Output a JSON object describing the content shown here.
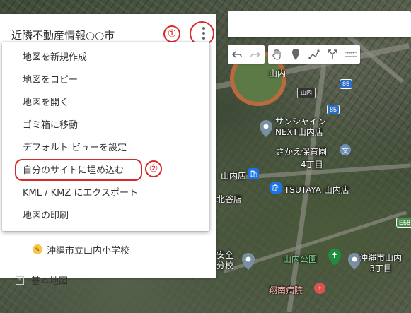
{
  "panel": {
    "title": "近隣不動産情報○○市",
    "school_label": "沖縄市立山内小学校",
    "basemap_label": "基本地図"
  },
  "menu": {
    "items": [
      "地図を新規作成",
      "地図をコピー",
      "地図を開く",
      "ゴミ箱に移動",
      "デフォルト ビューを設定",
      "自分のサイトに埋め込む",
      "KML / KMZ にエクスポート",
      "地図の印刷"
    ]
  },
  "annotations": {
    "badge_1": "①",
    "badge_2": "②"
  },
  "search": {
    "placeholder": ""
  },
  "toolbar": {
    "icons": [
      "undo-icon",
      "redo-icon",
      "hand-icon",
      "marker-icon",
      "line-icon",
      "directions-icon",
      "ruler-icon"
    ]
  },
  "map": {
    "labels": {
      "yamauchi": "山内",
      "yamauchi_sign": "山内",
      "sunshine": "サンシャイン\nNEXT山内店",
      "sakae": "さかえ保育園",
      "yonchome": "4丁目",
      "yamauchi_store": "山内店",
      "tsutaya": "TSUTAYA 山内店",
      "kitaya": "北谷店",
      "park": "山内公園",
      "okinawa_3": "沖縄市山内\n3丁目",
      "hospital": "翔南病院",
      "anzen": "安全\n分校"
    },
    "route_badges": {
      "r85a": "85",
      "r85b": "85",
      "e58": "E58"
    }
  },
  "colors": {
    "annotation_red": "#d62a2a",
    "track_orange": "#b96a3e",
    "poi_blue": "#1a73e8",
    "poi_green": "#1e8e3e",
    "hospital_red": "#d9534f"
  }
}
